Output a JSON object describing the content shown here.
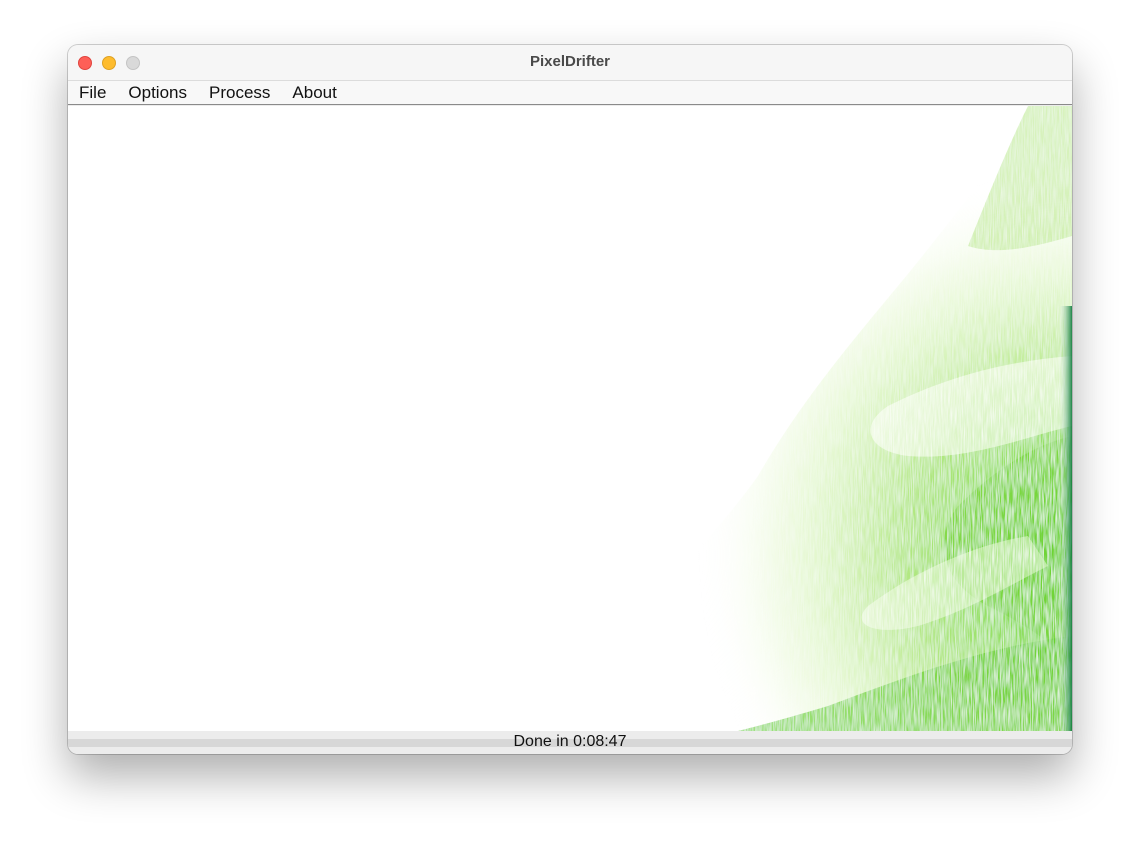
{
  "window": {
    "title": "PixelDrifter"
  },
  "menubar": {
    "items": [
      {
        "label": "File"
      },
      {
        "label": "Options"
      },
      {
        "label": "Process"
      },
      {
        "label": "About"
      }
    ]
  },
  "canvas": {
    "accent_colors": [
      "#7ed321",
      "#3fbf1a",
      "#0a8a3a",
      "#b8ec7c"
    ]
  },
  "status": {
    "text": "Done in 0:08:47",
    "progress": 1.0
  }
}
